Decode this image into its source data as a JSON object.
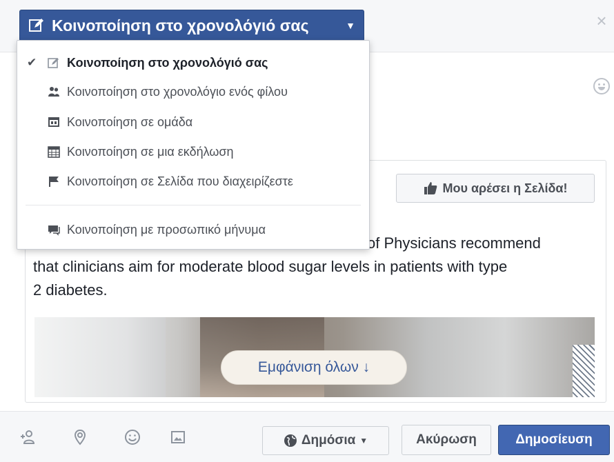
{
  "header": {
    "share_target_label": "Κοινοποίηση στο χρονολόγιό σας",
    "close_symbol": "×"
  },
  "share_menu": {
    "items": [
      {
        "label": "Κοινοποίηση στο χρονολόγιό σας",
        "icon": "edit-icon",
        "selected": true
      },
      {
        "label": "Κοινοποίηση στο χρονολόγιο ενός φίλου",
        "icon": "friends-icon",
        "selected": false
      },
      {
        "label": "Κοινοποίηση σε ομάδα",
        "icon": "group-icon",
        "selected": false
      },
      {
        "label": "Κοινοποίηση σε μια εκδήλωση",
        "icon": "calendar-icon",
        "selected": false
      },
      {
        "label": "Κοινοποίηση σε Σελίδα που διαχειρίζεστε",
        "icon": "flag-icon",
        "selected": false
      },
      {
        "label": "Κοινοποίηση με προσωπικό μήνυμα",
        "icon": "message-icon",
        "selected": false
      }
    ]
  },
  "post": {
    "like_page_label": "Μου αρέσει η Σελίδα!",
    "text_line1": "of Physicians recommend",
    "text_line2": "that clinicians aim for moderate blood sugar levels in patients with type",
    "text_line3": "2 diabetes.",
    "show_all_label": "Εμφάνιση όλων ↓"
  },
  "footer": {
    "icons": [
      "tag-friends-icon",
      "location-pin-icon",
      "emoji-icon",
      "photo-icon"
    ],
    "audience_label": "Δημόσια",
    "cancel_label": "Ακύρωση",
    "post_label": "Δημοσίευση"
  },
  "colors": {
    "brand_blue": "#365899",
    "post_button_blue": "#4267b2"
  }
}
